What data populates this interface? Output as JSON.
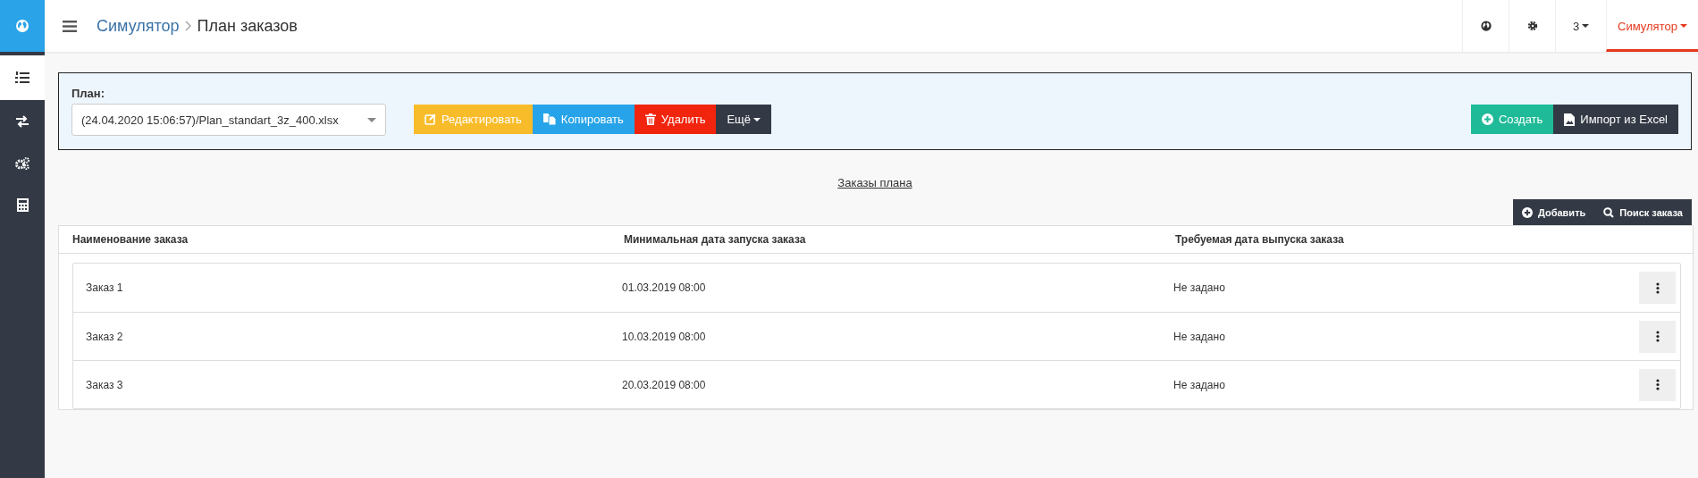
{
  "sidebar": {
    "items": [
      {
        "kind": "globe",
        "selected": false
      },
      {
        "kind": "list",
        "selected": true
      },
      {
        "kind": "arrows",
        "selected": false
      },
      {
        "kind": "gears",
        "selected": false
      },
      {
        "kind": "calculator",
        "selected": false
      }
    ]
  },
  "header": {
    "breadcrumb": {
      "parent": "Симулятор",
      "current": "План заказов"
    },
    "count": "3",
    "user": "Симулятор"
  },
  "plan_panel": {
    "label": "План:",
    "select_value": "(24.04.2020 15:06:57)/Plan_standart_3z_400.xlsx",
    "actions": [
      {
        "kind": "edit",
        "label": "Редактировать"
      },
      {
        "kind": "copy",
        "label": "Копировать"
      },
      {
        "kind": "delete",
        "label": "Удалить"
      },
      {
        "kind": "more",
        "label": "Ещё"
      }
    ],
    "right_actions": [
      {
        "kind": "create",
        "label": "Создать"
      },
      {
        "kind": "import",
        "label": "Импорт из Excel"
      }
    ]
  },
  "orders_link": "Заказы плана",
  "table_actions": [
    {
      "kind": "add",
      "label": "Добавить"
    },
    {
      "kind": "search",
      "label": "Поиск заказа"
    }
  ],
  "table": {
    "columns": [
      "Наименование заказа",
      "Минимальная дата запуска заказа",
      "Требуемая дата выпуска заказа"
    ],
    "rows": [
      {
        "name": "Заказ 1",
        "start": "01.03.2019 08:00",
        "due": "Не задано"
      },
      {
        "name": "Заказ 2",
        "start": "10.03.2019 08:00",
        "due": "Не задано"
      },
      {
        "name": "Заказ 3",
        "start": "20.03.2019 08:00",
        "due": "Не задано"
      }
    ]
  }
}
